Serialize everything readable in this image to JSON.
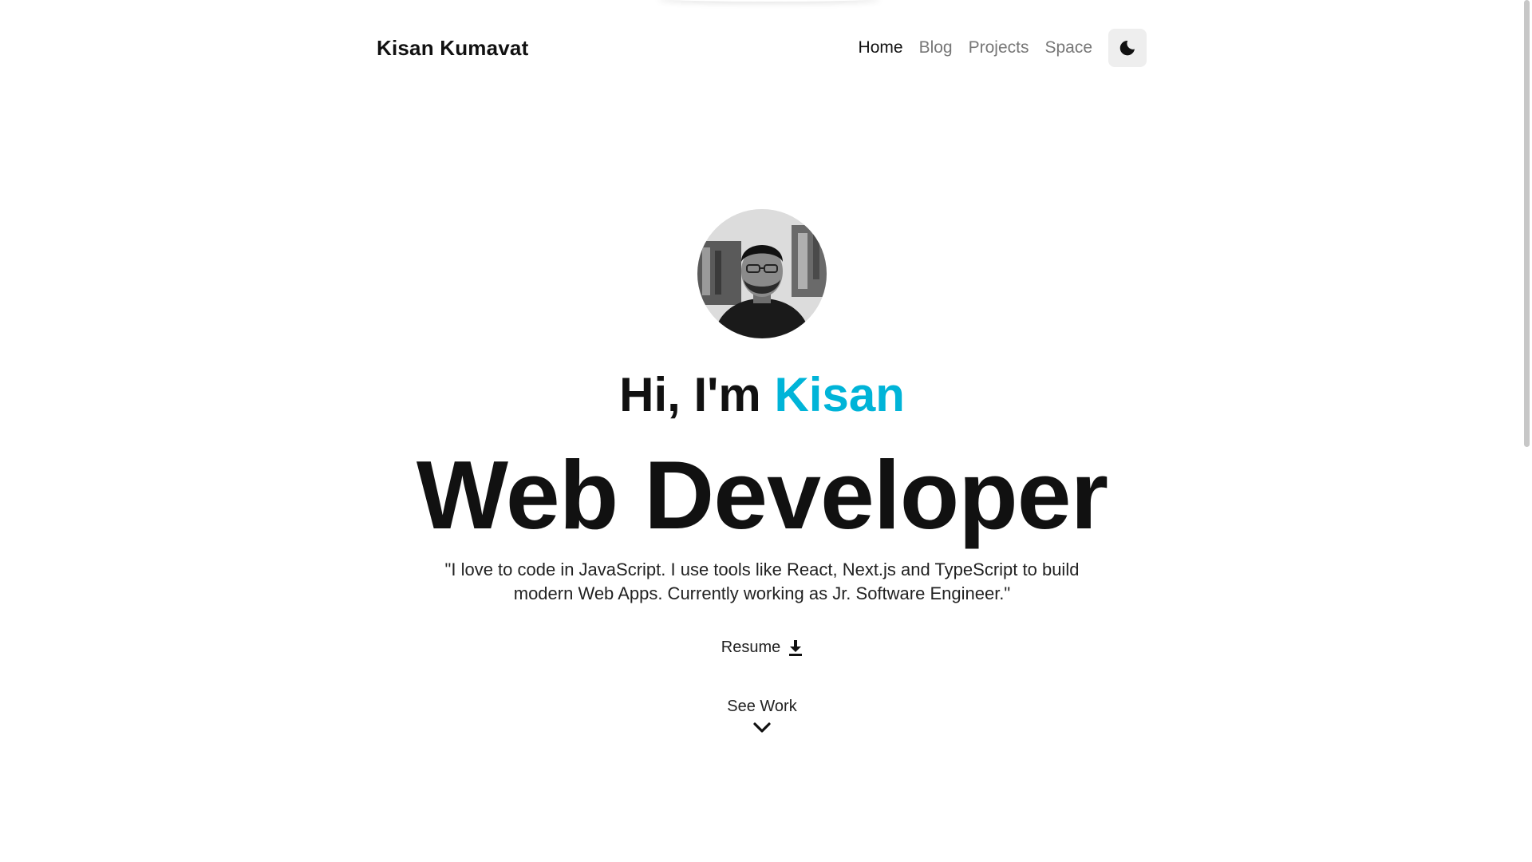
{
  "header": {
    "brand": "Kisan Kumavat",
    "nav": [
      {
        "label": "Home",
        "active": true
      },
      {
        "label": "Blog",
        "active": false
      },
      {
        "label": "Projects",
        "active": false
      },
      {
        "label": "Space",
        "active": false
      }
    ],
    "theme_toggle_icon": "moon-icon"
  },
  "hero": {
    "greeting_prefix": "Hi, I'm ",
    "greeting_name": "Kisan",
    "role": "Web Developer",
    "bio": "\"I love to code in JavaScript. I use tools like React, Next.js and TypeScript to build modern Web Apps. Currently working as Jr. Software Engineer.\"",
    "resume_label": "Resume",
    "resume_icon": "download-icon",
    "see_work_label": "See Work",
    "see_work_icon": "chevron-down-icon"
  },
  "colors": {
    "accent": "#00b4d8",
    "text": "#111111",
    "muted": "#777777",
    "toggle_bg": "#eeeeee"
  }
}
